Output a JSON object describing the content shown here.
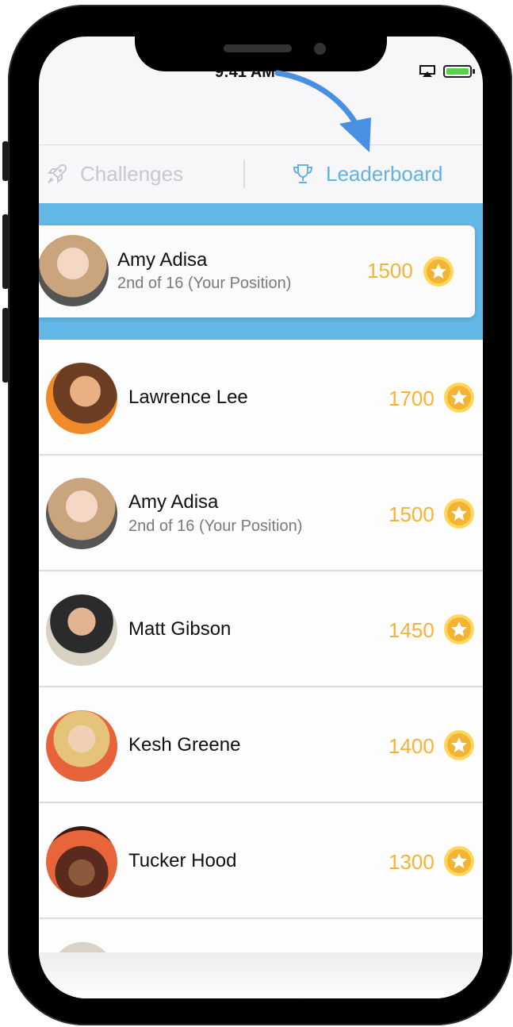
{
  "status_bar": {
    "time": "9:41 AM"
  },
  "tabs": {
    "challenges_label": "Challenges",
    "leaderboard_label": "Leaderboard"
  },
  "current_user": {
    "name": "Amy Adisa",
    "position": "2nd of 16 (Your Position)",
    "score": "1500"
  },
  "leaderboard": [
    {
      "name": "Lawrence Lee",
      "subtitle": "",
      "score": "1700"
    },
    {
      "name": "Amy Adisa",
      "subtitle": "2nd of 16 (Your Position)",
      "score": "1500"
    },
    {
      "name": "Matt Gibson",
      "subtitle": "",
      "score": "1450"
    },
    {
      "name": "Kesh Greene",
      "subtitle": "",
      "score": "1400"
    },
    {
      "name": "Tucker Hood",
      "subtitle": "",
      "score": "1300"
    }
  ],
  "colors": {
    "accent_blue": "#63b8e7",
    "score_gold": "#f5b336",
    "arrow_blue": "#4a90e2"
  }
}
